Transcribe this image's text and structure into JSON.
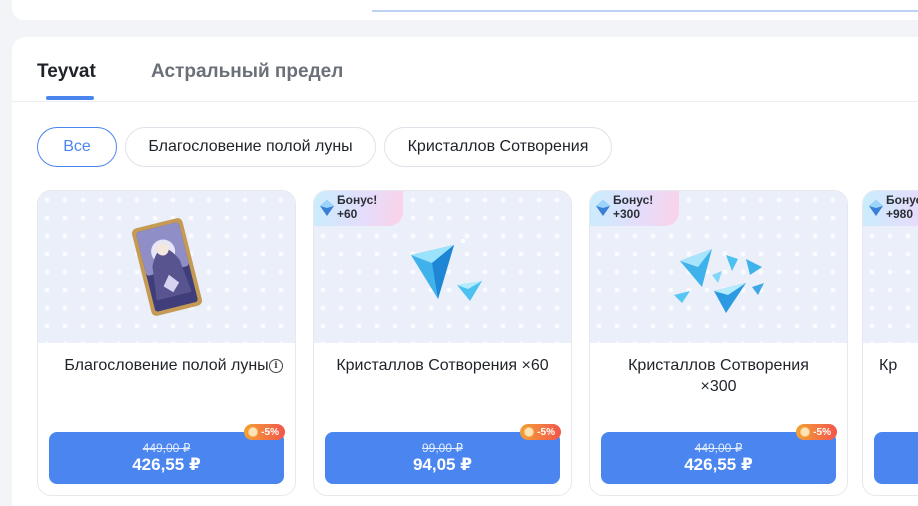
{
  "tabs": [
    {
      "label": "Teyvat",
      "active": true
    },
    {
      "label": "Астральный предел",
      "active": false
    }
  ],
  "filters": [
    {
      "label": "Все",
      "active": true
    },
    {
      "label": "Благословение полой луны",
      "active": false
    },
    {
      "label": "Кристаллов Сотворения",
      "active": false
    }
  ],
  "cards": [
    {
      "name": "Благословение полой луны",
      "old_price": "449,00 ₽",
      "price": "426,55 ₽",
      "discount": "-5%",
      "info_icon": "info-icon",
      "image": "moon-card-icon"
    },
    {
      "name": "Кристаллов Сотворения ×60",
      "old_price": "99,00 ₽",
      "price": "94,05 ₽",
      "discount": "-5%",
      "bonus_label": "Бонус!",
      "bonus_value": "+60",
      "image": "crystal-small-icon"
    },
    {
      "name": "Кристаллов Сотворения ×300",
      "old_price": "449,00 ₽",
      "price": "426,55 ₽",
      "discount": "-5%",
      "bonus_label": "Бонус!",
      "bonus_value": "+300",
      "image": "crystal-medium-icon"
    },
    {
      "name": "Кр",
      "bonus_label": "Бонус!",
      "bonus_value": "+980"
    }
  ],
  "colors": {
    "accent": "#4b86f0",
    "discount_start": "#f3a034",
    "discount_end": "#f2564c"
  }
}
